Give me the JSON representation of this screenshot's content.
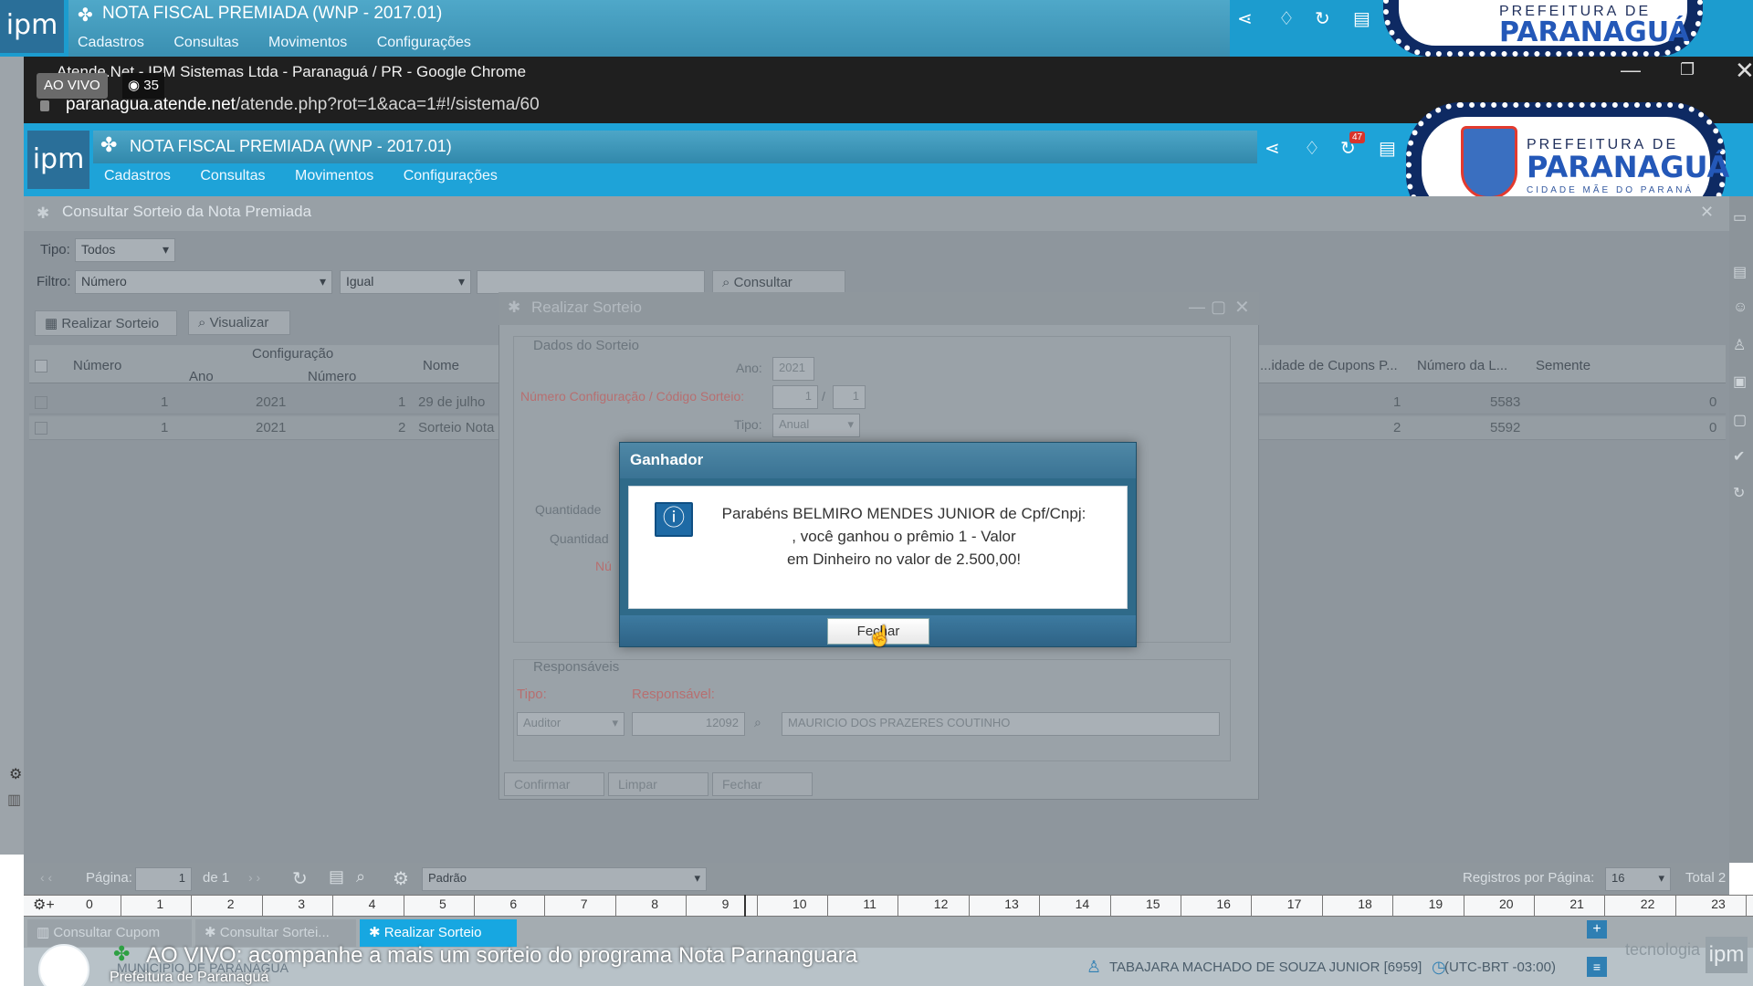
{
  "back_window": {
    "title": "NOTA FISCAL PREMIADA (WNP - 2017.01)",
    "menu": [
      "Cadastros",
      "Consultas",
      "Movimentos",
      "Configurações"
    ]
  },
  "chrome": {
    "title": "Atende.Net - IPM Sistemas Ltda - Paranaguá / PR - Google Chrome",
    "url_domain": "paranagua.atende.net",
    "url_path": "/atende.php?rot=1&aca=1#!/sistema/60",
    "live_label": "AO VIVO",
    "viewers": "35"
  },
  "app": {
    "logo": "ipm",
    "title": "NOTA FISCAL PREMIADA (WNP - 2017.01)",
    "menu": [
      "Cadastros",
      "Consultas",
      "Movimentos",
      "Configurações"
    ],
    "notifications": "47",
    "panel_title": "Consultar Sorteio da Nota Premiada",
    "filters": {
      "tipo_label": "Tipo:",
      "tipo_value": "Todos",
      "filtro_label": "Filtro:",
      "filtro_field": "Número",
      "filtro_op": "Igual",
      "consultar": "Consultar"
    },
    "actions": [
      "Realizar Sorteio",
      "Visualizar"
    ],
    "grid": {
      "group_header": "Configuração",
      "headers": [
        "Número",
        "Ano",
        "Número",
        "Nome",
        "...idade de Cupons P...",
        "Número da L...",
        "Semente"
      ],
      "rows": [
        {
          "numero": "1",
          "ano": "2021",
          "cfg_numero": "1",
          "nome": "29 de julho",
          "cupons": "1",
          "loteria": "5583",
          "semente": "0"
        },
        {
          "numero": "1",
          "ano": "2021",
          "cfg_numero": "2",
          "nome": "Sorteio Nota",
          "cupons": "2",
          "loteria": "5592",
          "semente": "0"
        }
      ]
    }
  },
  "inner_dialog": {
    "title": "Realizar Sorteio",
    "section1": "Dados do Sorteio",
    "ano_label": "Ano:",
    "ano_value": "2021",
    "config_label": "Número Configuração / Código Sorteio:",
    "config_value1": "1",
    "config_value2": "1",
    "tipo_label": "Tipo:",
    "tipo_value": "Anual",
    "qtd_label1": "Quantidade",
    "qtd_label2": "Quantidad",
    "num_label": "Nú",
    "section2": "Responsáveis",
    "resp_tipo_label": "Tipo:",
    "resp_label": "Responsável:",
    "resp_tipo": "Auditor",
    "resp_code": "12092",
    "resp_name": "MAURICIO DOS PRAZERES COUTINHO",
    "buttons": [
      "Confirmar",
      "Limpar",
      "Fechar"
    ]
  },
  "winner_modal": {
    "title": "Ganhador",
    "line1": "Parabéns BELMIRO MENDES JUNIOR de Cpf/Cnpj:",
    "line2": ", você ganhou o prêmio 1 - Valor",
    "line3": "em Dinheiro no valor de 2.500,00!",
    "close_button": "Fechar"
  },
  "pager": {
    "page_label": "Página:",
    "page_value": "1",
    "of": "de 1",
    "layout": "Padrão",
    "per_page_label": "Registros por Página:",
    "per_page": "16",
    "total": "Total 2"
  },
  "ruler_ticks": [
    "0",
    "1",
    "2",
    "3",
    "4",
    "5",
    "6",
    "7",
    "8",
    "9",
    "10",
    "11",
    "12",
    "13",
    "14",
    "15",
    "16",
    "17",
    "18",
    "19",
    "20",
    "21",
    "22",
    "23"
  ],
  "tasks": [
    "Consultar Cupom",
    "Consultar Sortei...",
    "Realizar Sorteio"
  ],
  "status": {
    "user": "TABAJARA MACHADO DE SOUZA JUNIOR [6959]",
    "timezone": "(UTC-BRT -03:00)",
    "brand": "tecnologia"
  },
  "stream": {
    "caption": "AO VIVO: acompanhe a mais um sorteio do programa Nota Parnanguara",
    "channel": "Prefeitura de Paranaguá",
    "municipio": "MUNICIPIO DE PARANAGUA"
  },
  "city_logo": {
    "line1": "PREFEITURA DE",
    "line2": "PARANAGUÁ",
    "line3": "CIDADE MÃE DO PARANÁ"
  },
  "colors": {
    "app_blue": "#1ea3d8",
    "modal_header": "#3a7394",
    "active_task": "#17a7e1",
    "logo_navy": "#0e2a63"
  }
}
